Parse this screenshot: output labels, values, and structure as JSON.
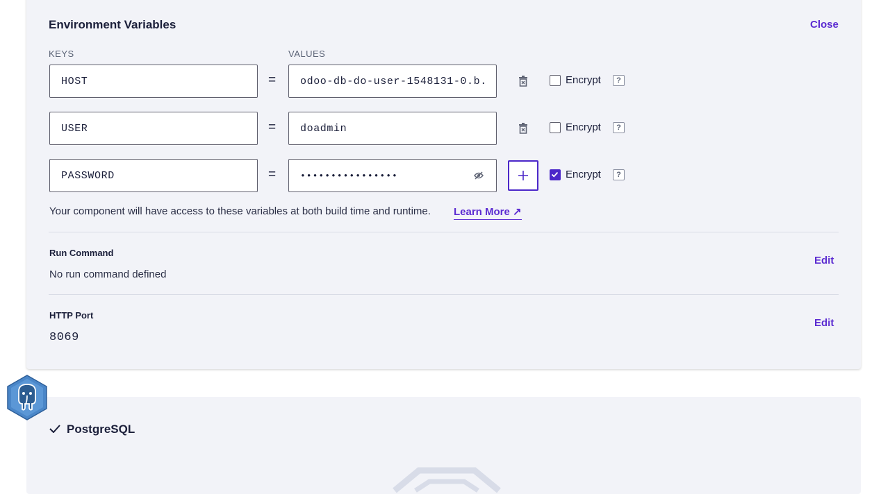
{
  "env": {
    "title": "Environment Variables",
    "close_label": "Close",
    "keys_header": "KEYS",
    "values_header": "VALUES",
    "rows": [
      {
        "key": "HOST",
        "value": "odoo-db-do-user-1548131-0.b.",
        "encrypt_checked": false
      },
      {
        "key": "USER",
        "value": "doadmin",
        "encrypt_checked": false
      },
      {
        "key": "PASSWORD",
        "value": "••••••••••••••••",
        "encrypt_checked": true
      }
    ],
    "equals": "=",
    "encrypt_label": "Encrypt",
    "help_label": "?",
    "note": "Your component will have access to these variables at both build time and runtime.",
    "learn_more": "Learn More ↗"
  },
  "run_command": {
    "title": "Run Command",
    "value": "No run command defined",
    "edit_label": "Edit"
  },
  "http_port": {
    "title": "HTTP Port",
    "value": "8069",
    "edit_label": "Edit"
  },
  "postgres": {
    "title": "PostgreSQL"
  },
  "colors": {
    "accent": "#4b27c9",
    "link": "#5b2bd1",
    "card_bg": "#f2f3f8",
    "text": "#1b1f3a"
  }
}
